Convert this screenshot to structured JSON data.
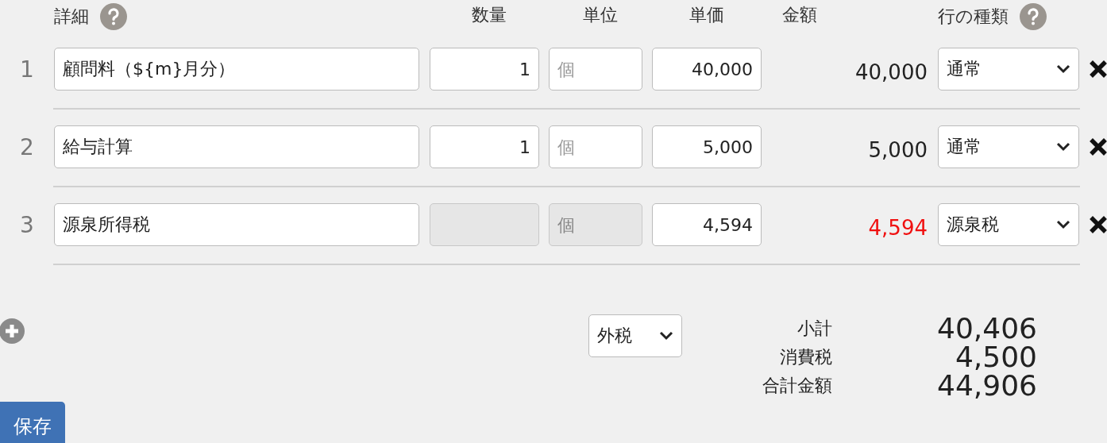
{
  "header": {
    "detail": "詳細",
    "quantity": "数量",
    "unit": "単位",
    "price": "単価",
    "amount": "金額",
    "row_type": "行の種類"
  },
  "rows": [
    {
      "number": "1",
      "detail": "顧問料（${m}月分）",
      "quantity": "1",
      "quantity_disabled": false,
      "unit_placeholder": "個",
      "unit_disabled": false,
      "price": "40,000",
      "amount": "40,000",
      "kind": "normal",
      "row_type": "通常"
    },
    {
      "number": "2",
      "detail": "給与計算",
      "quantity": "1",
      "quantity_disabled": false,
      "unit_placeholder": "個",
      "unit_disabled": false,
      "price": "5,000",
      "amount": "5,000",
      "kind": "normal",
      "row_type": "通常"
    },
    {
      "number": "3",
      "detail": "源泉所得税",
      "quantity_disabled": true,
      "unit_placeholder": "個",
      "unit_disabled": true,
      "price": "4,594",
      "amount": "4,594",
      "kind": "withholding",
      "row_type": "源泉税"
    }
  ],
  "tax_mode": "外税",
  "totals": [
    {
      "label": "小計",
      "value": "40,406"
    },
    {
      "label": "消費税",
      "value": "4,500"
    },
    {
      "label": "合計金額",
      "value": "44,906"
    }
  ],
  "save_button": "保存"
}
